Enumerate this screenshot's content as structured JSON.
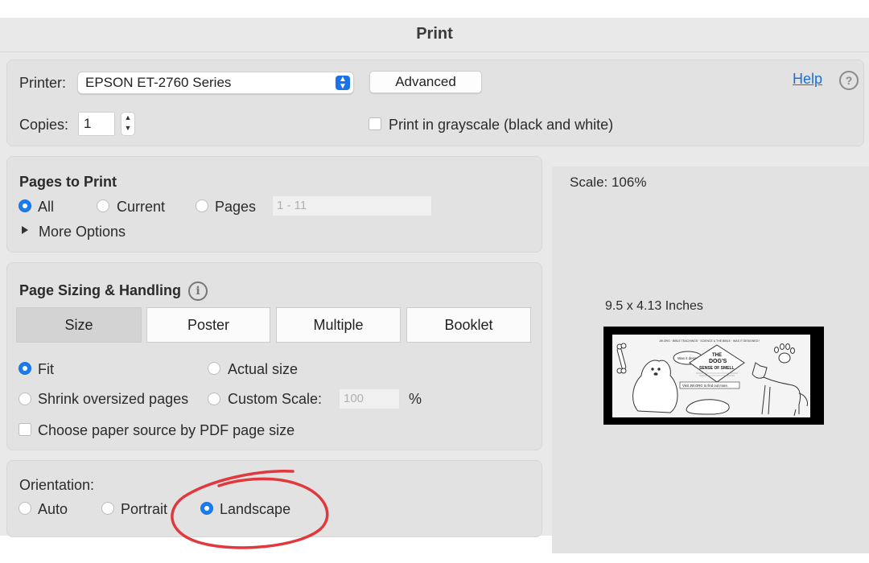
{
  "dialog": {
    "title": "Print"
  },
  "top": {
    "printer_label": "Printer:",
    "printer_value": "EPSON ET-2760 Series",
    "advanced_label": "Advanced",
    "help_label": "Help",
    "copies_label": "Copies:",
    "copies_value": "1",
    "grayscale_label": "Print in grayscale (black and white)",
    "grayscale_checked": false
  },
  "pages_to_print": {
    "title": "Pages to Print",
    "options": [
      "All",
      "Current",
      "Pages"
    ],
    "selected": "All",
    "range_placeholder": "1 - 11",
    "more_options_label": "More Options"
  },
  "page_sizing": {
    "title": "Page Sizing & Handling",
    "tabs": [
      "Size",
      "Poster",
      "Multiple",
      "Booklet"
    ],
    "selected_tab": "Size",
    "fit_label": "Fit",
    "actual_size_label": "Actual size",
    "shrink_label": "Shrink oversized pages",
    "custom_scale_label": "Custom Scale:",
    "custom_scale_value": "100",
    "percent_symbol": "%",
    "selected": "Fit",
    "paper_source_label": "Choose paper source by PDF page size",
    "paper_source_checked": false
  },
  "orientation": {
    "title": "Orientation:",
    "options": [
      "Auto",
      "Portrait",
      "Landscape"
    ],
    "selected": "Landscape"
  },
  "preview": {
    "scale_label": "Scale: 106%",
    "page_size_label": "9.5 x 4.13 Inches",
    "sheet": {
      "header_text": "JW.ORG · BIBLE TEACHINGS · SCIENCE & THE BIBLE · WAS IT DESIGNED?",
      "bubble_text": "Was it designed?",
      "title_line1": "THE",
      "title_line2": "DOG'S",
      "title_line3": "SENSE OF SMELL",
      "caption": "Visit JW.ORG to find out more."
    }
  },
  "colors": {
    "accent": "#1a7cf0",
    "link": "#1a6fd8",
    "annotation": "#e0383d"
  }
}
